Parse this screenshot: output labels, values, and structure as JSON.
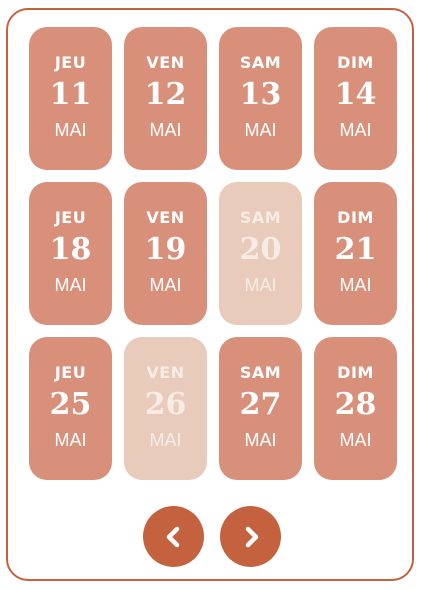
{
  "calendar": {
    "days": [
      {
        "weekday": "JEU",
        "day": "11",
        "month": "MAI",
        "available": true
      },
      {
        "weekday": "VEN",
        "day": "12",
        "month": "MAI",
        "available": true
      },
      {
        "weekday": "SAM",
        "day": "13",
        "month": "MAI",
        "available": true
      },
      {
        "weekday": "DIM",
        "day": "14",
        "month": "MAI",
        "available": true
      },
      {
        "weekday": "JEU",
        "day": "18",
        "month": "MAI",
        "available": true
      },
      {
        "weekday": "VEN",
        "day": "19",
        "month": "MAI",
        "available": true
      },
      {
        "weekday": "SAM",
        "day": "20",
        "month": "MAI",
        "available": false
      },
      {
        "weekday": "DIM",
        "day": "21",
        "month": "MAI",
        "available": true
      },
      {
        "weekday": "JEU",
        "day": "25",
        "month": "MAI",
        "available": true
      },
      {
        "weekday": "VEN",
        "day": "26",
        "month": "MAI",
        "available": false
      },
      {
        "weekday": "SAM",
        "day": "27",
        "month": "MAI",
        "available": true
      },
      {
        "weekday": "DIM",
        "day": "28",
        "month": "MAI",
        "available": true
      }
    ]
  },
  "navigation": {
    "prev_icon": "chevron-left-icon",
    "next_icon": "chevron-right-icon"
  },
  "colors": {
    "accent": "#c4623f",
    "day_available": "#d9907b",
    "day_unavailable": "#e9cbbb",
    "text_on_day": "#ffffff"
  }
}
